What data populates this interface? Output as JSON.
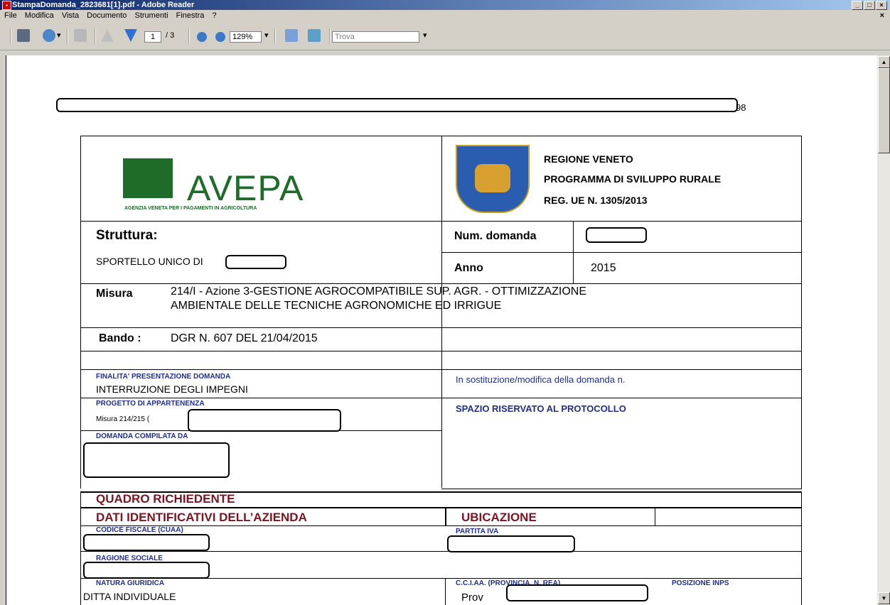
{
  "window": {
    "title": "StampaDomanda_2823681[1].pdf - Adobe Reader"
  },
  "menu": {
    "items": [
      "File",
      "Modifica",
      "Vista",
      "Documento",
      "Strumenti",
      "Finestra",
      "?"
    ]
  },
  "toolbar": {
    "page_current": "1",
    "page_total": "/ 3",
    "zoom": "129%",
    "find_placeholder": "Trova"
  },
  "doc": {
    "header_suffix": "98",
    "avepa_logo": "AVEPA",
    "avepa_subtitle": "AGENZIA VENETA PER I PAGAMENTI IN AGRICOLTURA",
    "region": [
      "REGIONE VENETO",
      "PROGRAMMA DI SVILUPPO RURALE",
      "REG. UE N. 1305/2013"
    ],
    "struttura_label": "Struttura:",
    "struttura_value": "SPORTELLO UNICO DI",
    "num_domanda_label": "Num. domanda",
    "anno_label": "Anno",
    "anno_value": "2015",
    "misura_label": "Misura",
    "misura_text_1": "214/I - Azione 3-GESTIONE AGROCOMPATIBILE SUP. AGR. - OTTIMIZZAZIONE",
    "misura_text_2": "AMBIENTALE DELLE TECNICHE AGRONOMICHE ED IRRIGUE",
    "bando_label": "Bando :",
    "bando_value": "DGR N. 607 DEL 21/04/2015",
    "finalita_label": "FINALITA' PRESENTAZIONE DOMANDA",
    "finalita_value": "INTERRUZIONE DEGLI IMPEGNI",
    "sostituzione_label": "In sostituzione/modifica della domanda n.",
    "progetto_label": "PROGETTO DI APPARTENENZA",
    "progetto_value": "Misura 214/215 (",
    "protocollo_label": "SPAZIO RISERVATO AL PROTOCOLLO",
    "compilata_label": "DOMANDA COMPILATA DA",
    "quadro_richiedente": "QUADRO RICHIEDENTE",
    "dati_identificativi": "DATI IDENTIFICATIVI DELL’AZIENDA",
    "ubicazione": "UBICAZIONE",
    "codice_fiscale_label": "CODICE FISCALE (CUAA)",
    "partita_iva_label": "PARTITA IVA",
    "ragione_sociale_label": "RAGIONE SOCIALE",
    "natura_giuridica_label": "NATURA GIURIDICA",
    "natura_giuridica_value": "DITTA INDIVIDUALE",
    "cciaa_label": "C.C.I.AA. (PROVINCIA, N. REA)",
    "cciaa_value": "Prov",
    "posizione_inps_label": "POSIZIONE INPS"
  }
}
